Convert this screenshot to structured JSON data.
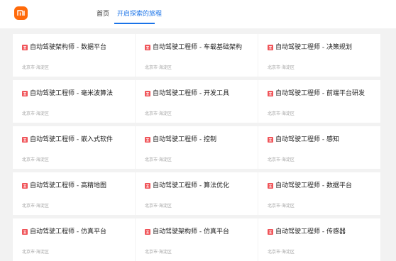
{
  "header": {
    "logo_text": "mi",
    "tabs": [
      {
        "label": "首页"
      },
      {
        "label": "开启探索的旅程"
      }
    ]
  },
  "jobs": [
    {
      "title": "自动驾驶架构师 - 数据平台",
      "location": "北京市·海淀区"
    },
    {
      "title": "自动驾驶工程师 - 车载基础架构",
      "location": "北京市·海淀区"
    },
    {
      "title": "自动驾驶工程师 - 决策规划",
      "location": "北京市·海淀区"
    },
    {
      "title": "自动驾驶工程师 - 毫米波算法",
      "location": "北京市·海淀区"
    },
    {
      "title": "自动驾驶工程师 - 开发工具",
      "location": "北京市·海淀区"
    },
    {
      "title": "自动驾驶工程师 - 前端平台研发",
      "location": "北京市·海淀区"
    },
    {
      "title": "自动驾驶工程师 - 嵌入式软件",
      "location": "北京市·海淀区"
    },
    {
      "title": "自动驾驶工程师 - 控制",
      "location": "北京市·海淀区"
    },
    {
      "title": "自动驾驶工程师 - 感知",
      "location": "北京市·海淀区"
    },
    {
      "title": "自动驾驶工程师 - 高精地图",
      "location": "北京市·海淀区"
    },
    {
      "title": "自动驾驶工程师 - 算法优化",
      "location": "北京市·海淀区"
    },
    {
      "title": "自动驾驶工程师 - 数据平台",
      "location": "北京市·海淀区"
    },
    {
      "title": "自动驾驶工程师 - 仿真平台",
      "location": "北京市·海淀区"
    },
    {
      "title": "自动驾驶架构师 - 仿真平台",
      "location": "北京市·海淀区"
    },
    {
      "title": "自动驾驶工程师 - 传感器",
      "location": "北京市·海淀区"
    }
  ],
  "colors": {
    "brand": "#ff6a0a",
    "accent": "#1a73e8",
    "badge": "#f0555a"
  },
  "icons": {
    "logo": "mi-logo-icon",
    "badge": "job-type-badge-icon"
  }
}
